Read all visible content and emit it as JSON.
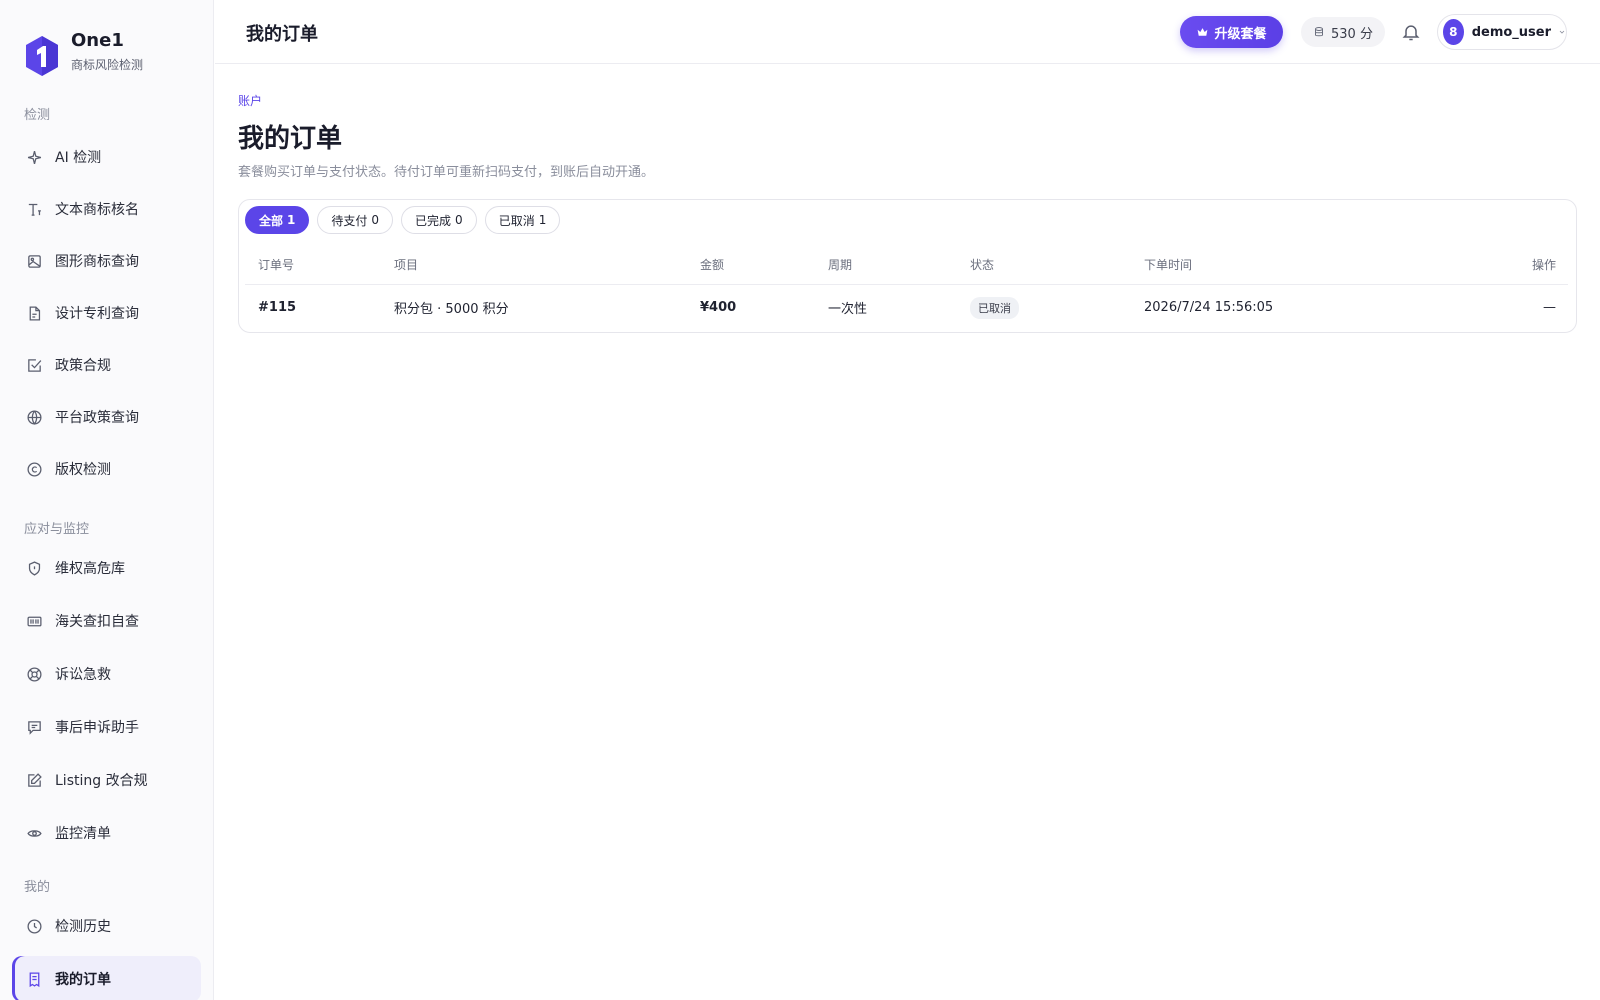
{
  "brand": {
    "name": "One1",
    "subtitle": "商标风险检测"
  },
  "sidebar": {
    "sections": [
      {
        "title": "检测"
      },
      {
        "title": "应对与监控"
      },
      {
        "title": "我的"
      }
    ],
    "items": [
      {
        "label": "AI 检测",
        "icon": "sparkle-icon"
      },
      {
        "label": "文本商标核名",
        "icon": "text-icon"
      },
      {
        "label": "图形商标查询",
        "icon": "image-icon"
      },
      {
        "label": "设计专利查询",
        "icon": "document-icon"
      },
      {
        "label": "政策合规",
        "icon": "check-square-icon"
      },
      {
        "label": "平台政策查询",
        "icon": "globe-icon"
      },
      {
        "label": "版权检测",
        "icon": "copyright-icon"
      },
      {
        "label": "维权高危库",
        "icon": "shield-icon"
      },
      {
        "label": "海关查扣自查",
        "icon": "scanner-icon"
      },
      {
        "label": "诉讼急救",
        "icon": "lifebuoy-icon"
      },
      {
        "label": "事后申诉助手",
        "icon": "chat-icon"
      },
      {
        "label": "Listing 改合规",
        "icon": "edit-icon"
      },
      {
        "label": "监控清单",
        "icon": "eye-icon"
      },
      {
        "label": "检测历史",
        "icon": "clock-icon"
      },
      {
        "label": "我的订单",
        "icon": "receipt-icon",
        "active": true
      }
    ]
  },
  "topbar": {
    "title": "我的订单",
    "upgrade_label": "升级套餐",
    "points_label": "530 分",
    "user": {
      "avatar_text": "8",
      "name": "demo_user"
    }
  },
  "main": {
    "breadcrumb": "账户",
    "title": "我的订单",
    "description": "套餐购买订单与支付状态。待付订单可重新扫码支付，到账后自动开通。",
    "filters": [
      {
        "label": "全部",
        "count": "1",
        "active": true
      },
      {
        "label": "待支付",
        "count": "0"
      },
      {
        "label": "已完成",
        "count": "0"
      },
      {
        "label": "已取消",
        "count": "1"
      }
    ],
    "table": {
      "columns": [
        "订单号",
        "项目",
        "金额",
        "周期",
        "状态",
        "下单时间",
        "操作"
      ],
      "rows": [
        {
          "id": "#115",
          "item": "积分包 · 5000 积分",
          "amount": "¥400",
          "period": "一次性",
          "status": "已取消",
          "time": "2026/7/24 15:56:05",
          "action": "—"
        }
      ]
    }
  },
  "colors": {
    "accent": "#5b45e8",
    "sidebar_bg": "#fafafc",
    "muted": "#8a8e9c"
  }
}
